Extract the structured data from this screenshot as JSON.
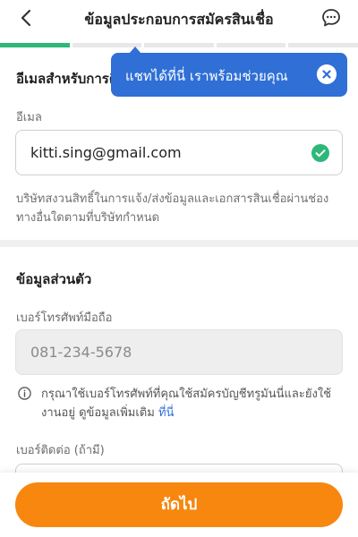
{
  "header": {
    "title": "ข้อมูลประกอบการสมัครสินเชื่อ",
    "back_icon": "chevron-left-icon",
    "chat_icon": "chat-bubble-icon"
  },
  "progress": {
    "total_steps": 5,
    "completed_steps": 1,
    "active_color": "#2db87a"
  },
  "tooltip": {
    "text": "แชทได้ที่นี่ เราพร้อมช่วยคุณ",
    "close_icon": "close-icon",
    "bg_color": "#2f6fd6"
  },
  "email_section": {
    "title": "อีเมลสำหรับการติดต่อ",
    "field_label": "อีเมล",
    "value": "kitti.sing@gmail.com",
    "valid_icon": "check-circle-icon",
    "note": "บริษัทสงวนสิทธิ์ในการแจ้ง/ส่งข้อมูลและเอกสารสินเชื่อผ่านช่องทางอื่นใดตามที่บริษัทกำหนด"
  },
  "personal_section": {
    "title": "ข้อมูลส่วนตัว",
    "mobile_label": "เบอร์โทรศัพท์มือถือ",
    "mobile_value": "081-234-5678",
    "info_icon": "info-icon",
    "info_text": "กรุณาใช้เบอร์โทรศัพท์ที่คุณใช้สมัครบัญชีทรูมันนี่และยังใช้งานอยู่ ดูข้อมูลเพิ่มเติม",
    "info_link": "ที่นี่",
    "contact_label": "เบอร์ติดต่อ (ถ้ามี)"
  },
  "footer": {
    "next_label": "ถัดไป",
    "button_color": "#f7870f"
  }
}
